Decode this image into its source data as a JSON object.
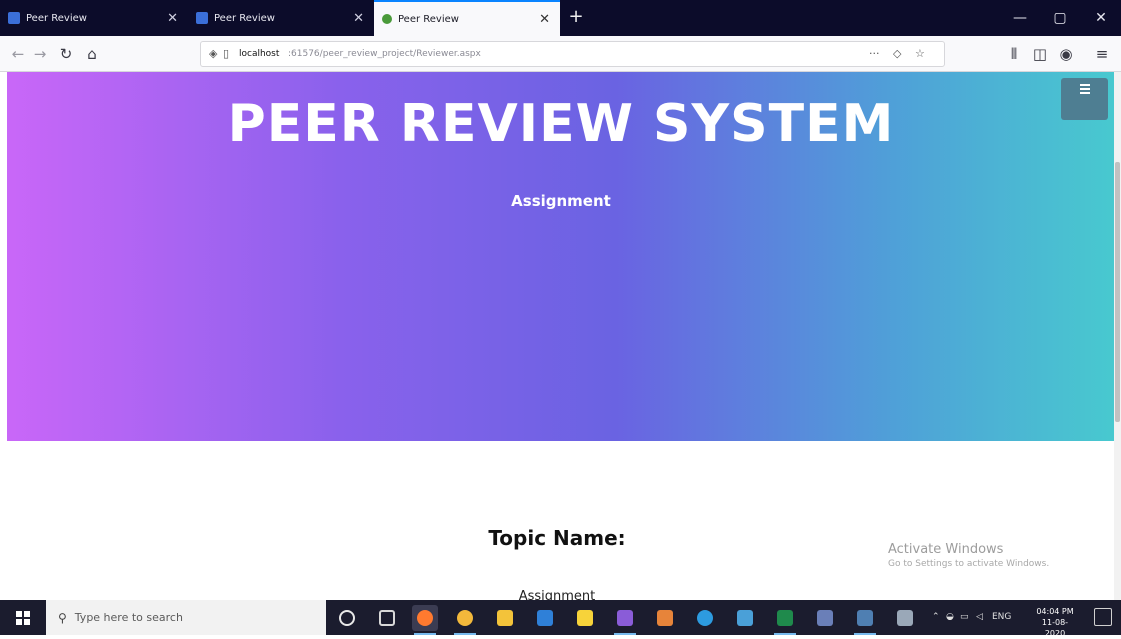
{
  "browser": {
    "tabs": [
      {
        "title": "Peer Review",
        "active": false
      },
      {
        "title": "Peer Review",
        "active": false
      },
      {
        "title": "Peer Review",
        "active": true
      }
    ],
    "new_tab_label": "+",
    "window_controls": {
      "minimize": "—",
      "maximize": "▢",
      "close": "✕"
    },
    "url_host": "localhost",
    "url_path": ":61576/peer_review_project/Reviewer.aspx",
    "more_label": "···"
  },
  "hero": {
    "title": "PEER REVIEW SYSTEM",
    "subtitle": "Assignment"
  },
  "content": {
    "topic_label": "Topic Name:",
    "topic_value": "Assignment"
  },
  "watermark": {
    "line1": "Activate Windows",
    "line2": "Go to Settings to activate Windows."
  },
  "taskbar": {
    "search_placeholder": "Type here to search",
    "language": "ENG",
    "time": "04:04 PM",
    "date": "11-08-2020"
  },
  "colors": {
    "gradient_start": "#c967f8",
    "gradient_mid": "#6a63e2",
    "gradient_end": "#48c9cf",
    "menu_button": "#4e7e92"
  }
}
